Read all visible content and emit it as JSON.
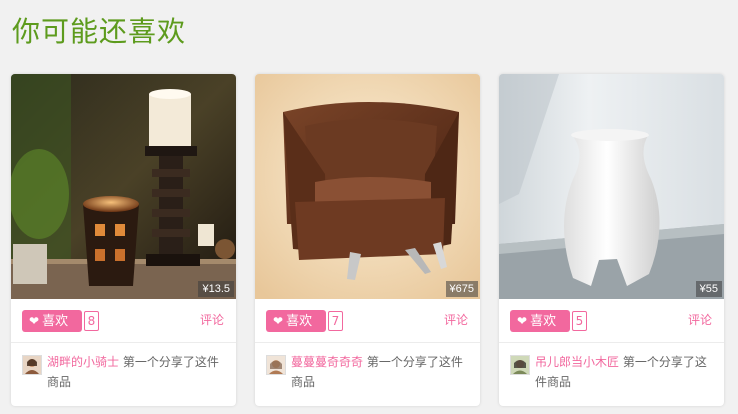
{
  "section": {
    "title": "你可能还喜欢"
  },
  "labels": {
    "like": "喜欢",
    "comment": "评论",
    "share_text": " 第一个分享了这件商品"
  },
  "colors": {
    "accent_pink": "#f2689e",
    "title_green": "#5d9b1d",
    "background": "#f1f1f1"
  },
  "icons": {
    "like": "heart-icon"
  },
  "products": [
    {
      "price": "¥13.5",
      "likes": "8",
      "user": "湖畔的小骑士",
      "image": "candles-photo"
    },
    {
      "price": "¥675",
      "likes": "7",
      "user": "蔓蔓蔓奇奇奇",
      "image": "armchair-photo"
    },
    {
      "price": "¥55",
      "likes": "5",
      "user": "吊儿郎当小木匠",
      "image": "white-vase-photo"
    }
  ]
}
